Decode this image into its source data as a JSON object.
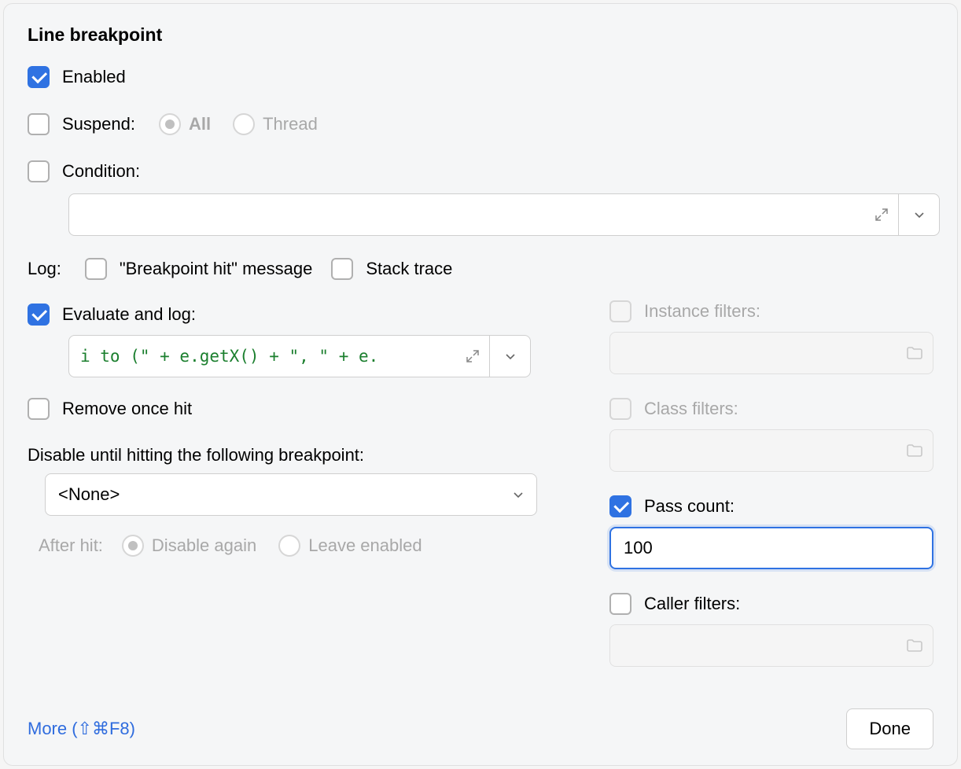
{
  "title": "Line breakpoint",
  "enabled": {
    "label": "Enabled",
    "checked": true
  },
  "suspend": {
    "label": "Suspend:",
    "checked": false,
    "options": {
      "all": "All",
      "thread": "Thread"
    },
    "selected": "all"
  },
  "condition": {
    "label": "Condition:",
    "checked": false,
    "value": ""
  },
  "log": {
    "label": "Log:",
    "bphit": {
      "label": "\"Breakpoint hit\" message",
      "checked": false
    },
    "stack": {
      "label": "Stack trace",
      "checked": false
    }
  },
  "eval": {
    "label": "Evaluate and log:",
    "checked": true,
    "value": "i to (\" + e.getX() + \", \" + e."
  },
  "remove": {
    "label": "Remove once hit",
    "checked": false
  },
  "disableUntil": {
    "label": "Disable until hitting the following breakpoint:",
    "selected": "<None>"
  },
  "afterHit": {
    "label": "After hit:",
    "disable": "Disable again",
    "leave": "Leave enabled"
  },
  "instanceFilters": {
    "label": "Instance filters:",
    "checked": false
  },
  "classFilters": {
    "label": "Class filters:",
    "checked": false
  },
  "passCount": {
    "label": "Pass count:",
    "checked": true,
    "value": "100"
  },
  "callerFilters": {
    "label": "Caller filters:",
    "checked": false
  },
  "moreLink": "More (⇧⌘F8)",
  "doneBtn": "Done"
}
